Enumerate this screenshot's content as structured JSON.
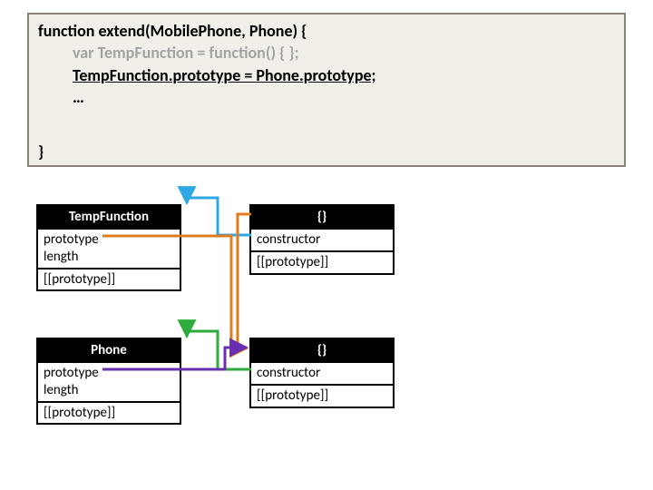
{
  "code": {
    "sig": "function extend(MobilePhone, Phone) {",
    "l1": "var TempFunction = function() { };",
    "l2": "TempFunction.prototype = Phone.prototype;",
    "l3": "…",
    "close": "}"
  },
  "boxes": {
    "tempFunction": {
      "title": "TempFunction",
      "p1a": "prototype",
      "p1b": "length",
      "p2": "[[prototype]]"
    },
    "tempProto": {
      "title": "{}",
      "p1": "constructor",
      "p2": "[[prototype]]"
    },
    "phone": {
      "title": "Phone",
      "p1a": "prototype",
      "p1b": "length",
      "p2": "[[prototype]]"
    },
    "phoneProto": {
      "title": "{}",
      "p1": "constructor",
      "p2": "[[prototype]]"
    }
  },
  "colors": {
    "blue": "#2ea8e5",
    "orange": "#e07b1f",
    "green": "#2faa3c",
    "purple": "#6a2fb0"
  }
}
